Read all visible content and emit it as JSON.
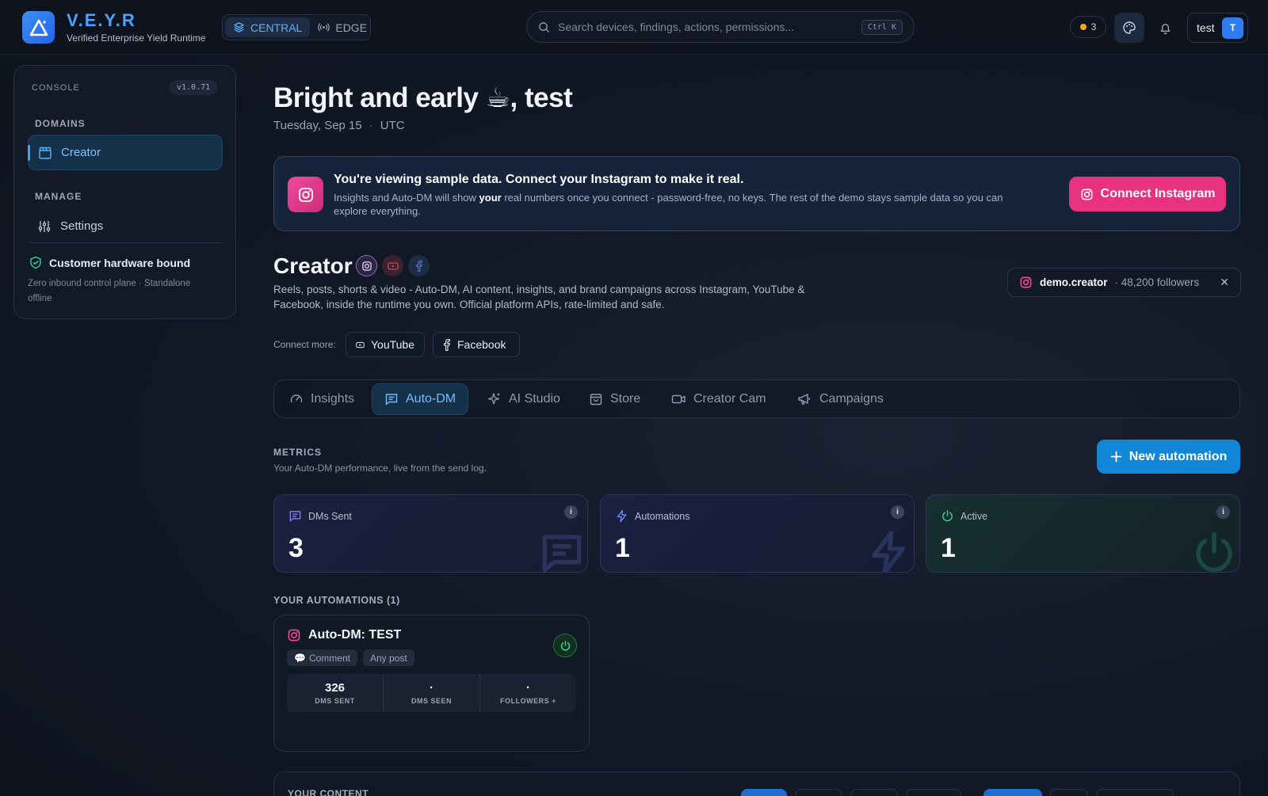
{
  "brand": {
    "name": "V.E.Y.R",
    "subtitle": "Verified Enterprise Yield Runtime"
  },
  "mode": {
    "central": "CENTRAL",
    "edge": "EDGE",
    "active": "CENTRAL"
  },
  "search": {
    "placeholder": "Search devices, findings, actions, permissions...",
    "shortcut": "Ctrl K"
  },
  "header": {
    "alert_count": "3",
    "user_name": "test",
    "user_initial": "T"
  },
  "sidebar": {
    "console_label": "CONSOLE",
    "version": "v1.0.71",
    "domains_heading": "DOMAINS",
    "domains": [
      {
        "label": "Creator",
        "active": true
      }
    ],
    "manage_heading": "MANAGE",
    "manage": [
      {
        "label": "Settings"
      }
    ],
    "hardware_title": "Customer hardware bound",
    "hardware_sub": "Zero inbound control plane · Standalone offline"
  },
  "greeting": {
    "text": "Bright and early ☕, test",
    "date": "Tuesday, Sep 15",
    "tz": "UTC"
  },
  "banner": {
    "title": "You're viewing sample data. Connect your Instagram to make it real.",
    "text_pre": "Insights and Auto-DM will show ",
    "text_bold": "your",
    "text_post": " real numbers once you connect - password-free, no keys. The rest of the demo stays sample data so you can explore everything.",
    "button": "Connect Instagram"
  },
  "creator": {
    "title": "Creator",
    "description": "Reels, posts, shorts & video - Auto-DM, AI content, insights, and brand campaigns across Instagram, YouTube & Facebook, inside the runtime you own. Official platform APIs, rate-limited and safe.",
    "account_handle": "demo.creator",
    "account_followers": "· 48,200 followers",
    "connect_more_label": "Connect more:",
    "connect_more": [
      "YouTube",
      "Facebook"
    ]
  },
  "tabs": [
    {
      "label": "Insights",
      "icon": "gauge-icon"
    },
    {
      "label": "Auto-DM",
      "icon": "message-icon",
      "active": true
    },
    {
      "label": "AI Studio",
      "icon": "sparkle-icon"
    },
    {
      "label": "Store",
      "icon": "store-icon"
    },
    {
      "label": "Creator Cam",
      "icon": "video-icon"
    },
    {
      "label": "Campaigns",
      "icon": "megaphone-icon"
    }
  ],
  "metrics": {
    "heading": "METRICS",
    "sub": "Your Auto-DM performance, live from the send log.",
    "new_button": "New automation",
    "cards": [
      {
        "label": "DMs Sent",
        "value": "3",
        "color": "#8b7cf6"
      },
      {
        "label": "Automations",
        "value": "1",
        "color": "#6f8cff"
      },
      {
        "label": "Active",
        "value": "1",
        "color": "#34d399"
      }
    ]
  },
  "automations": {
    "heading": "YOUR AUTOMATIONS (1)",
    "items": [
      {
        "title": "Auto-DM: TEST",
        "trigger": "Comment",
        "scope": "Any post",
        "stats": [
          {
            "value": "326",
            "label": "DMS SENT"
          },
          {
            "value": "·",
            "label": "DMS SEEN"
          },
          {
            "value": "·",
            "label": "FOLLOWERS +"
          }
        ]
      }
    ]
  },
  "content": {
    "heading": "YOUR CONTENT"
  },
  "colors": {
    "accent": "#3da2ff",
    "instagram": "#e8317f",
    "primary_button": "#1287d8"
  }
}
